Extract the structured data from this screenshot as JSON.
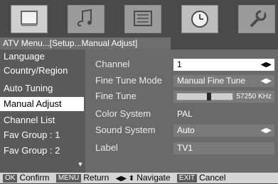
{
  "top_icons": [
    {
      "name": "picture-icon"
    },
    {
      "name": "sound-icon"
    },
    {
      "name": "channel-icon"
    },
    {
      "name": "time-icon"
    },
    {
      "name": "setup-icon"
    }
  ],
  "breadcrumb": "ATV Menu...[Setup...Manual Adjust]",
  "left_menu": {
    "items": [
      {
        "label": "Language"
      },
      {
        "label": "Country/Region"
      },
      {
        "label": "Auto Tuning"
      },
      {
        "label": "Manual Adjust",
        "selected": true
      },
      {
        "label": "Channel List"
      },
      {
        "label": "Fav Group : 1"
      },
      {
        "label": "Fav Group : 2"
      }
    ],
    "scroll_glyph": "▼"
  },
  "settings": {
    "channel": {
      "label": "Channel",
      "value": "1",
      "glyph": "◀▶"
    },
    "fine_tune_mode": {
      "label": "Fine Tune Mode",
      "value": "Manual Fine Tune",
      "glyph": "◀▶"
    },
    "fine_tune": {
      "label": "Fine Tune",
      "value": "57250",
      "unit": "KHz",
      "level": 0.58
    },
    "color_system": {
      "label": "Color System",
      "value": "PAL"
    },
    "sound_system": {
      "label": "Sound System",
      "value": "Auto",
      "glyph": "◀▶"
    },
    "label": {
      "label": "Label",
      "value": "TV1"
    }
  },
  "footer": {
    "ok_key": "OK",
    "ok_label": "Confirm",
    "menu_key": "MENU",
    "menu_label": "Return",
    "nav_glyph": "◀▶ ⬍",
    "nav_label": "Navigate",
    "exit_key": "EXIT",
    "exit_label": "Cancel"
  }
}
